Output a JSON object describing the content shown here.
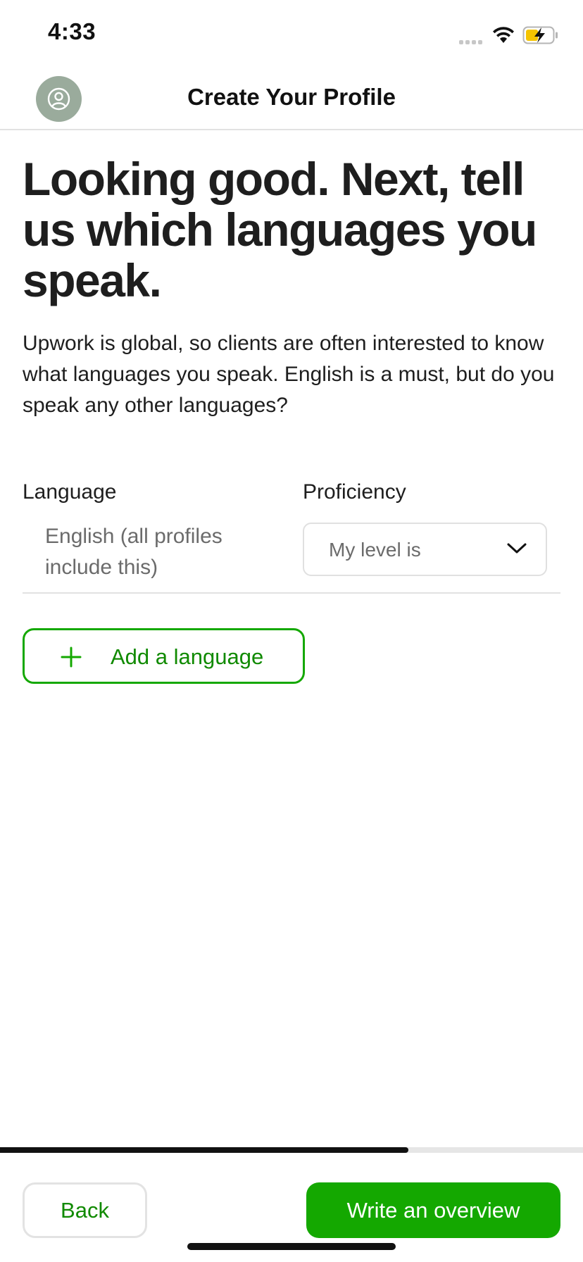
{
  "status_bar": {
    "time": "4:33"
  },
  "header": {
    "title": "Create Your Profile",
    "avatar_icon": "user-circle-icon"
  },
  "main": {
    "headline": "Looking good. Next, tell us which languages you speak.",
    "intro": "Upwork is global, so clients are often interested to know what languages you speak. English is a must, but do you speak any other languages?",
    "table": {
      "language_header": "Language",
      "proficiency_header": "Proficiency",
      "rows": [
        {
          "language": "English (all profiles include this)",
          "proficiency_placeholder": "My level is"
        }
      ]
    },
    "add_language_label": "Add a language"
  },
  "progress": {
    "fraction": 0.7
  },
  "footer": {
    "back_label": "Back",
    "next_label": "Write an overview"
  },
  "colors": {
    "accent": "#14a800",
    "accent_text": "#108a00",
    "avatar_bg": "#9aab9c"
  }
}
